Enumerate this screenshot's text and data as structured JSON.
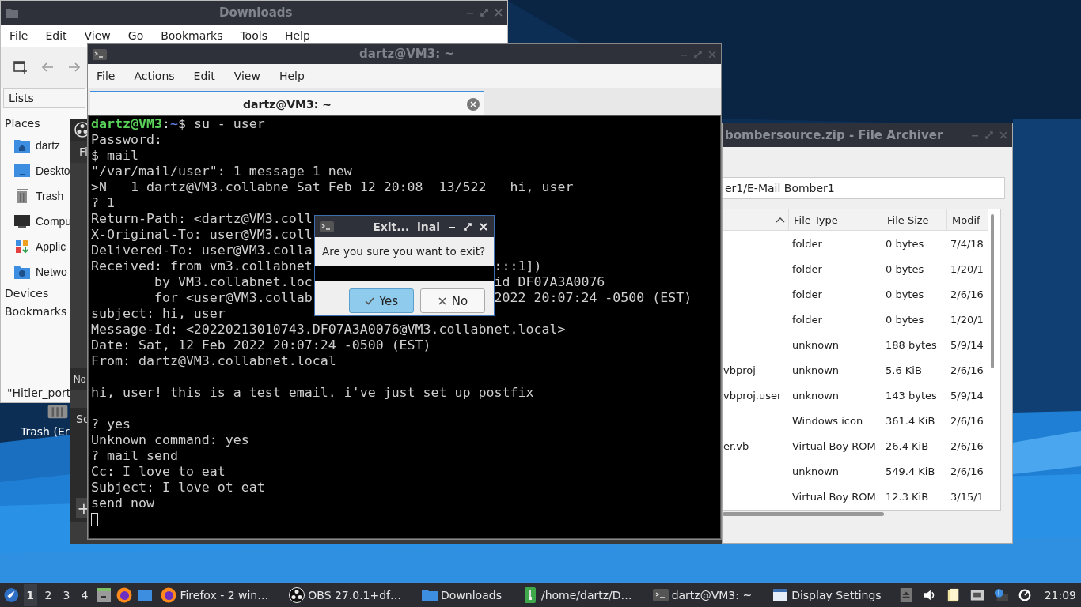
{
  "file_manager": {
    "title": "Downloads",
    "menu": [
      "File",
      "Edit",
      "View",
      "Go",
      "Bookmarks",
      "Tools",
      "Help"
    ],
    "side_selector": "Lists",
    "places_heading": "Places",
    "places": [
      {
        "label": "dartz",
        "kind": "home"
      },
      {
        "label": "Deskto",
        "kind": "desktop"
      },
      {
        "label": "Trash",
        "kind": "trash"
      },
      {
        "label": "Compu",
        "kind": "computer"
      },
      {
        "label": "Applic",
        "kind": "apps"
      },
      {
        "label": "Netwo",
        "kind": "network"
      }
    ],
    "sections": [
      "Devices",
      "Bookmarks"
    ],
    "status": "\"Hitler_port"
  },
  "desktop_icon": {
    "label": "Trash (Er"
  },
  "obs_window": {
    "menu": "Fi",
    "dock_1": "No",
    "dock_2": "Sc",
    "add": "+"
  },
  "terminal": {
    "title": "dartz@VM3: ~",
    "menu": [
      "File",
      "Actions",
      "Edit",
      "View",
      "Help"
    ],
    "tab": {
      "label": "dartz@VM3: ~",
      "selected": true
    },
    "lines": [
      {
        "kind": "prompt",
        "user": "dartz@VM3",
        "sep": ":",
        "path": "~",
        "command": "$ su - user"
      },
      {
        "kind": "text",
        "text": "Password:"
      },
      {
        "kind": "text",
        "text": "$ mail"
      },
      {
        "kind": "text",
        "text": "\"/var/mail/user\": 1 message 1 new"
      },
      {
        "kind": "text",
        "text": ">N   1 dartz@VM3.collabne Sat Feb 12 20:08  13/522   hi, user"
      },
      {
        "kind": "text",
        "text": "? 1"
      },
      {
        "kind": "split",
        "text": "Return-Path: <dartz@VM3.coll"
      },
      {
        "kind": "split",
        "text": "X-Original-To: user@VM3.coll"
      },
      {
        "kind": "split",
        "text": "Delivered-To: user@VM3.colla"
      },
      {
        "kind": "split",
        "text": "Received: from vm3.collabnet",
        "right": ":::1])"
      },
      {
        "kind": "split",
        "text": "        by VM3.collabnet.loc",
        "right": "id DF07A3A0076"
      },
      {
        "kind": "split",
        "text": "        for <user@VM3.collab",
        "right": "2022 20:07:24 -0500 (EST)"
      },
      {
        "kind": "text",
        "text": "subject: hi, user"
      },
      {
        "kind": "text",
        "text": "Message-Id: <20220213010743.DF07A3A0076@VM3.collabnet.local>"
      },
      {
        "kind": "text",
        "text": "Date: Sat, 12 Feb 2022 20:07:24 -0500 (EST)"
      },
      {
        "kind": "text",
        "text": "From: dartz@VM3.collabnet.local"
      },
      {
        "kind": "blank"
      },
      {
        "kind": "text",
        "text": "hi, user! this is a test email. i've just set up postfix"
      },
      {
        "kind": "blank"
      },
      {
        "kind": "text",
        "text": "? yes"
      },
      {
        "kind": "text",
        "text": "Unknown command: yes"
      },
      {
        "kind": "text",
        "text": "? mail send"
      },
      {
        "kind": "text",
        "text": "Cc: I love to eat"
      },
      {
        "kind": "text",
        "text": "Subject: I love ot eat"
      },
      {
        "kind": "text",
        "text": "send now"
      },
      {
        "kind": "cursor"
      }
    ]
  },
  "dialog": {
    "title": "Exit...  inal",
    "message": "Are you sure you want to exit?",
    "buttons": [
      {
        "label": "Yes",
        "kind": "yes",
        "selected": true
      },
      {
        "label": "No",
        "kind": "no",
        "selected": false
      }
    ]
  },
  "archiver": {
    "title": "bombersource.zip - File Archiver",
    "path": "er1/E-Mail Bomber1",
    "columns": [
      "File Type",
      "File Size",
      "Modif"
    ],
    "rows": [
      {
        "type": "folder",
        "size": "0 bytes",
        "modified": "7/4/18"
      },
      {
        "type": "folder",
        "size": "0 bytes",
        "modified": "1/20/1"
      },
      {
        "type": "folder",
        "size": "0 bytes",
        "modified": "2/6/16"
      },
      {
        "type": "folder",
        "size": "0 bytes",
        "modified": "1/20/1"
      },
      {
        "type": "unknown",
        "size": "188 bytes",
        "modified": "5/9/14"
      },
      {
        "name": "vbproj",
        "type": "unknown",
        "size": "5.6 KiB",
        "modified": "2/6/16"
      },
      {
        "name": "vbproj.user",
        "type": "unknown",
        "size": "143 bytes",
        "modified": "5/9/14"
      },
      {
        "type": "Windows icon",
        "size": "361.4 KiB",
        "modified": "2/6/16"
      },
      {
        "name": "er.vb",
        "type": "Virtual Boy ROM",
        "size": "26.4 KiB",
        "modified": "2/6/16"
      },
      {
        "type": "unknown",
        "size": "549.4 KiB",
        "modified": "2/6/16"
      },
      {
        "type": "Virtual Boy ROM",
        "size": "12.3 KiB",
        "modified": "3/15/1"
      }
    ]
  },
  "taskbar": {
    "workspaces": [
      {
        "label": "1",
        "selected": true
      },
      {
        "label": "2",
        "selected": false
      },
      {
        "label": "3",
        "selected": false
      },
      {
        "label": "4",
        "selected": false
      }
    ],
    "launchers": [
      {
        "kind": "cabinet"
      },
      {
        "kind": "firefox"
      },
      {
        "kind": "window"
      }
    ],
    "tasks": [
      {
        "label": "Firefox - 2 win…",
        "kind": "firefox"
      },
      {
        "label": "OBS 27.0.1+df…",
        "kind": "obs"
      },
      {
        "label": "Downloads",
        "kind": "folder"
      },
      {
        "label": "/home/dartz/D…",
        "kind": "archive"
      },
      {
        "label": "dartz@VM3: ~",
        "kind": "terminal"
      },
      {
        "label": "Display Settings",
        "kind": "display"
      }
    ],
    "tray": [
      {
        "kind": "eject"
      },
      {
        "kind": "volume"
      },
      {
        "kind": "clipboard"
      },
      {
        "kind": "network"
      },
      {
        "kind": "alert"
      },
      {
        "kind": "update"
      }
    ],
    "clock": "21:09"
  }
}
